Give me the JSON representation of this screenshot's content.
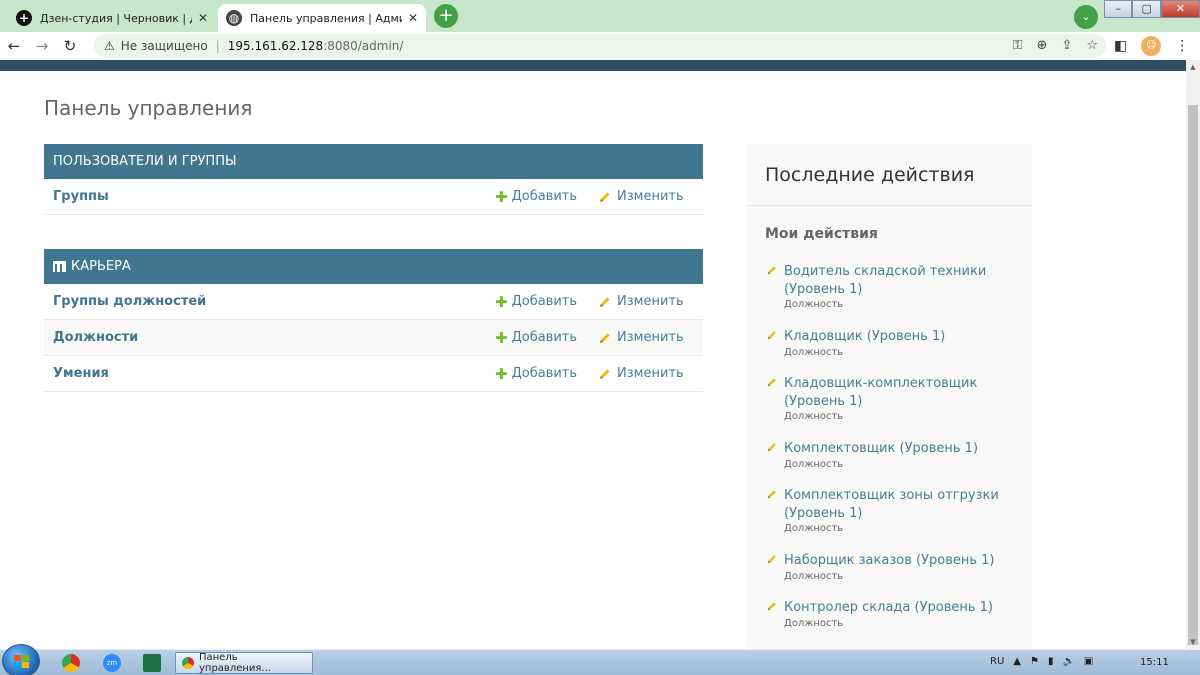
{
  "browser": {
    "tabs": [
      {
        "title": "Дзен-студия | Черновик | Дзен",
        "close": "✕",
        "active": false
      },
      {
        "title": "Панель управления | Администрирование",
        "close": "✕",
        "active": true
      }
    ],
    "new_tab": "+",
    "tab_search": "⌄",
    "window_buttons": {
      "minimize": "–",
      "maximize": "▢",
      "close": "✕"
    },
    "back": "←",
    "forward": "→",
    "reload": "↻",
    "security_label": "Не защищено",
    "url_host": "195.161.62.128",
    "url_rest": ":8080/admin/"
  },
  "page": {
    "title": "Панель управления",
    "modules": [
      {
        "caption": "ПОЛЬЗОВАТЕЛИ И ГРУППЫ",
        "rows": [
          {
            "name": "Группы",
            "add": "Добавить",
            "change": "Изменить"
          }
        ]
      },
      {
        "caption": "КАРЬЕРА",
        "rows": [
          {
            "name": "Группы должностей",
            "add": "Добавить",
            "change": "Изменить"
          },
          {
            "name": "Должности",
            "add": "Добавить",
            "change": "Изменить"
          },
          {
            "name": "Умения",
            "add": "Добавить",
            "change": "Изменить"
          }
        ]
      }
    ],
    "recent": {
      "title": "Последние действия",
      "subtitle": "Мои действия",
      "items": [
        {
          "text": "Водитель складской техники (Уровень 1)",
          "type": "Должность"
        },
        {
          "text": "Кладовщик (Уровень 1)",
          "type": "Должность"
        },
        {
          "text": "Кладовщик-комплектовщик (Уровень 1)",
          "type": "Должность"
        },
        {
          "text": "Комплектовщик (Уровень 1)",
          "type": "Должность"
        },
        {
          "text": "Комплектовщик зоны отгрузки (Уровень 1)",
          "type": "Должность"
        },
        {
          "text": "Наборщик заказов (Уровень 1)",
          "type": "Должность"
        },
        {
          "text": "Контролер склада (Уровень 1)",
          "type": "Должность"
        }
      ]
    }
  },
  "taskbar": {
    "task_label": "Панель управления...",
    "zoom_label": "zm",
    "language": "RU",
    "time": "15:11"
  },
  "colors": {
    "admin_header": "#2e4f63",
    "module_caption": "#417690",
    "link": "#447e9b",
    "add_plus": "#70bf2b",
    "pencil": "#efb80b",
    "browser_frame": "#c8e6c9"
  }
}
